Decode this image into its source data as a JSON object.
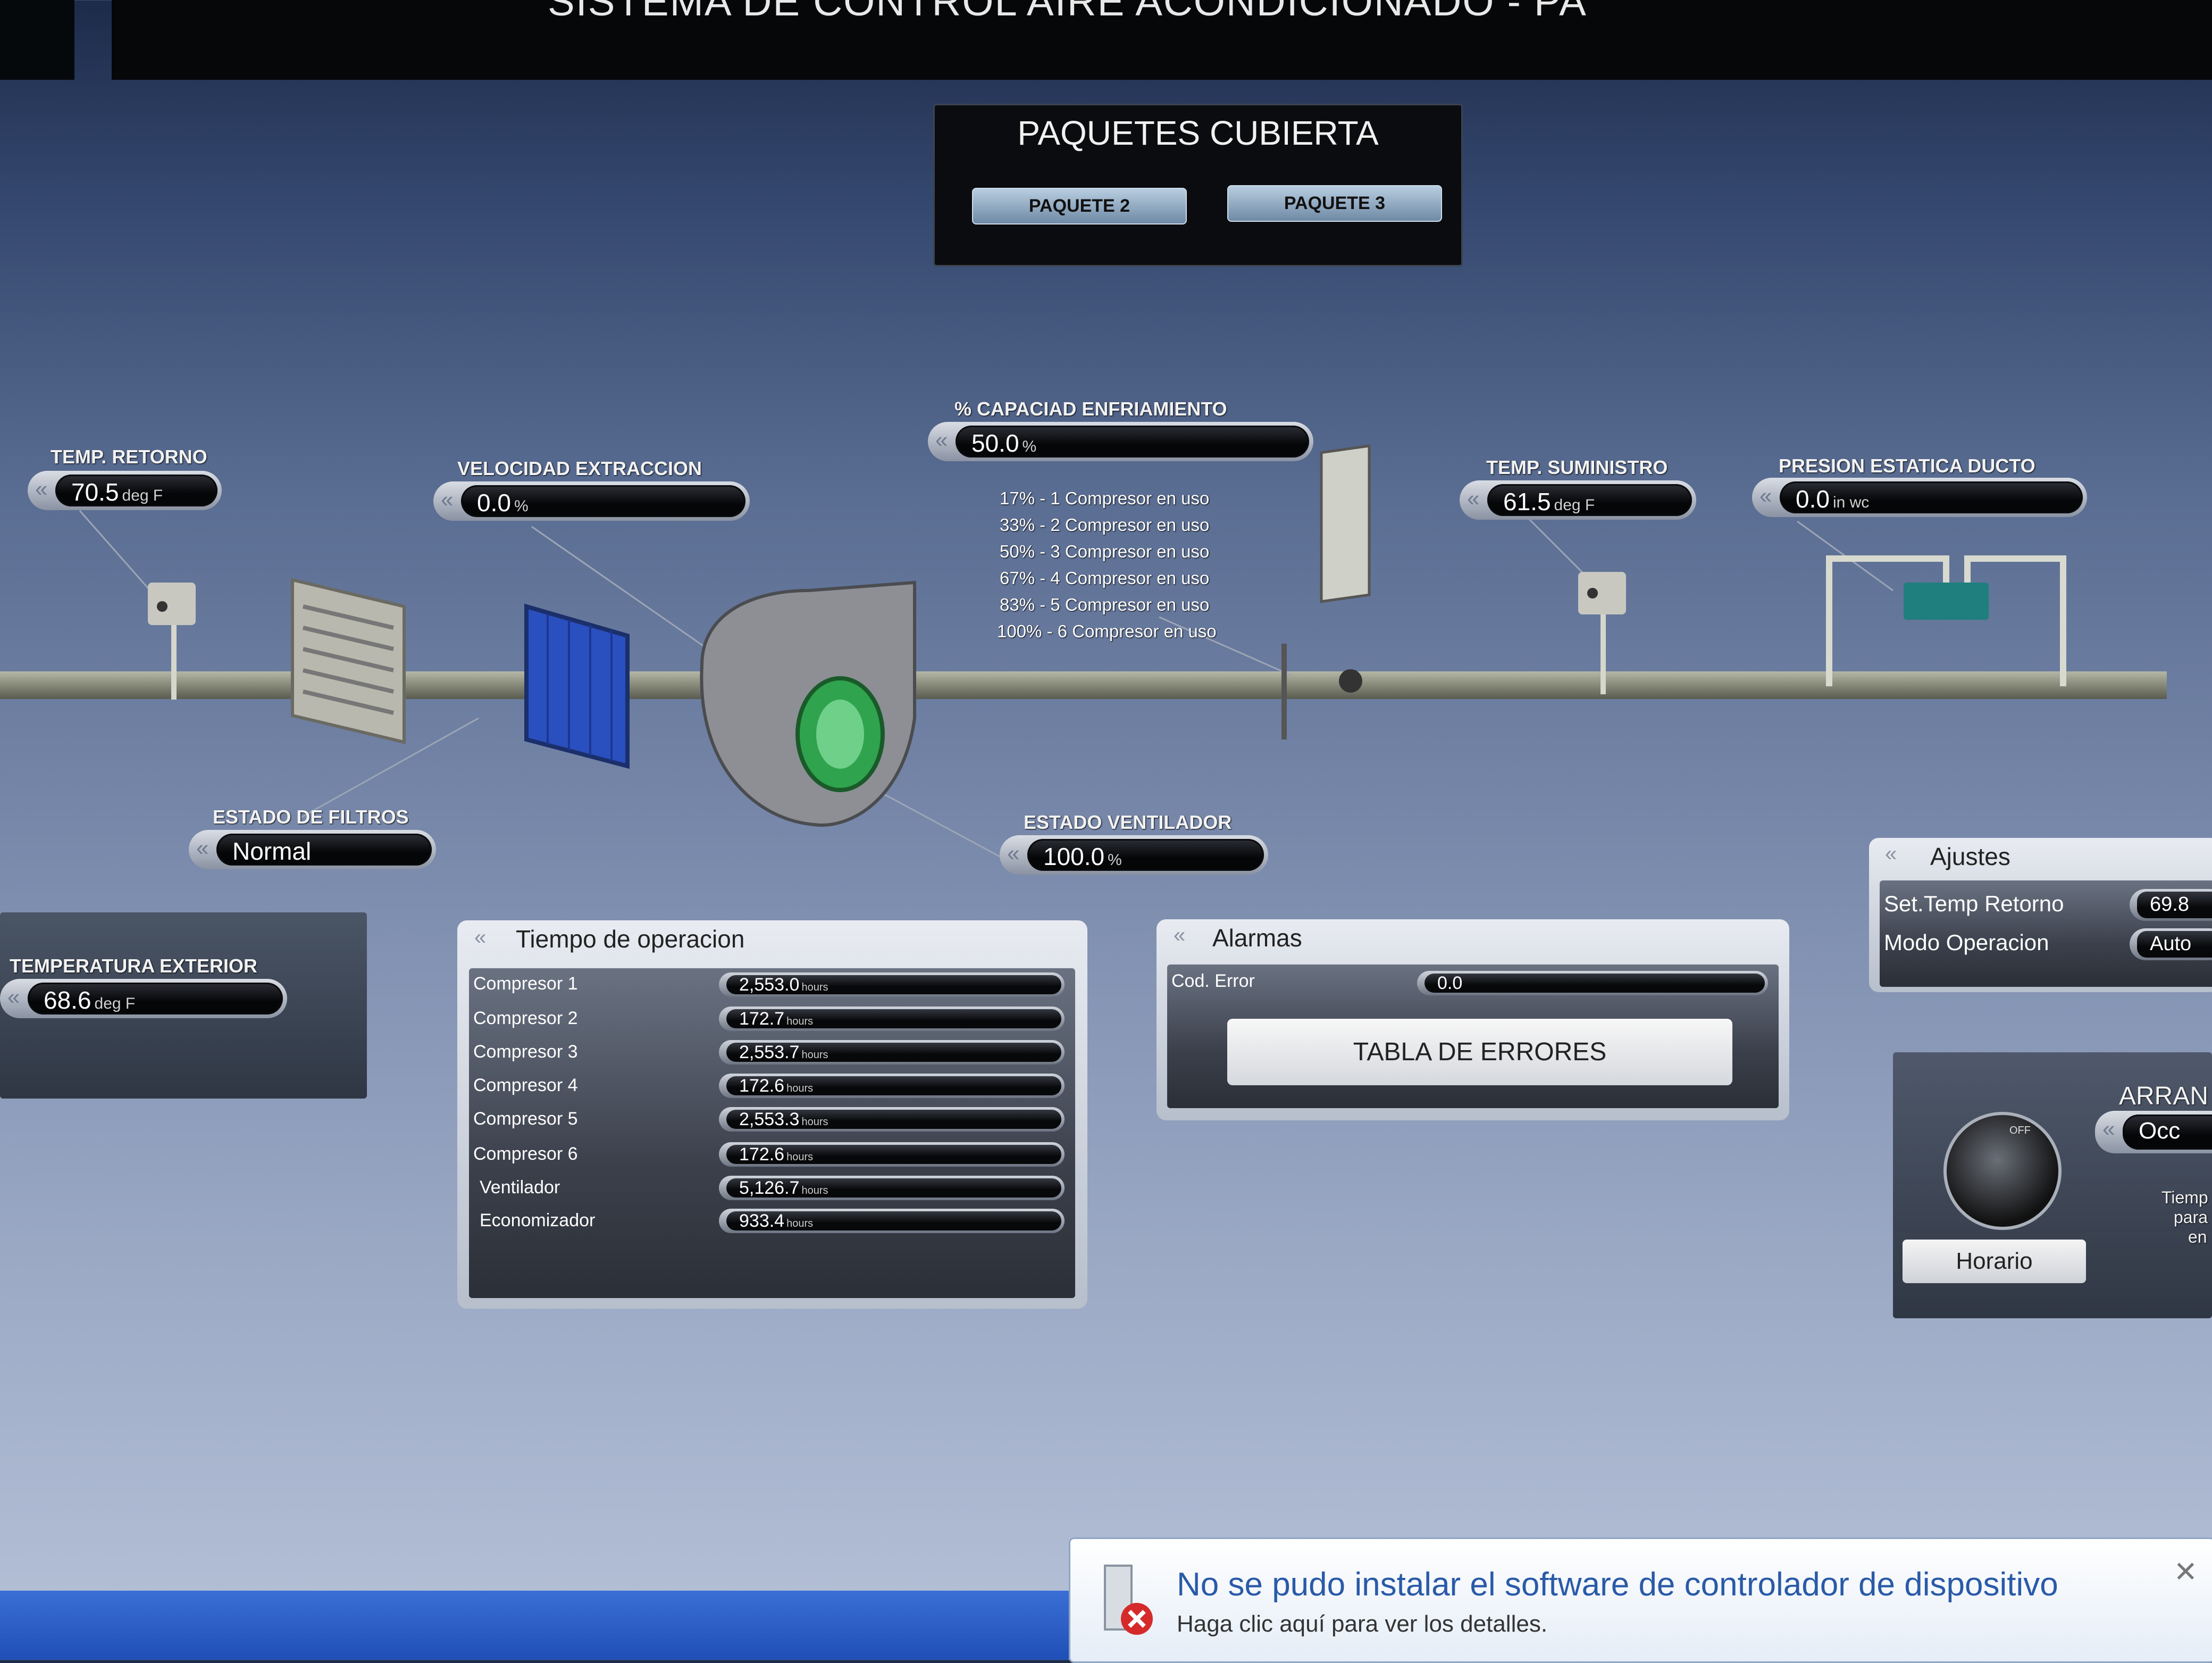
{
  "header": {
    "title": "SISTEMA DE CONTROL AIRE ACONDICIONADO - PA"
  },
  "paquetes": {
    "title": "PAQUETES CUBIERTA",
    "btn2": "PAQUETE 2",
    "btn3": "PAQUETE 3"
  },
  "sensors": {
    "temp_retorno": {
      "label": "TEMP. RETORNO",
      "value": "70.5",
      "unit": "deg F"
    },
    "vel_extraccion": {
      "label": "VELOCIDAD EXTRACCION",
      "value": "0.0",
      "unit": "%"
    },
    "capacidad": {
      "label": "% CAPACIAD ENFRIAMIENTO",
      "value": "50.0",
      "unit": "%"
    },
    "temp_suministro": {
      "label": "TEMP. SUMINISTRO",
      "value": "61.5",
      "unit": "deg F"
    },
    "presion": {
      "label": "PRESION ESTATICA  DUCTO",
      "value": "0.0",
      "unit": "in wc"
    },
    "estado_filtros": {
      "label": "ESTADO DE FILTROS",
      "value": "Normal"
    },
    "estado_ventilador": {
      "label": "ESTADO VENTILADOR",
      "value": "100.0",
      "unit": "%"
    },
    "temp_exterior": {
      "label": "TEMPERATURA EXTERIOR",
      "value": "68.6",
      "unit": "deg F"
    }
  },
  "compresores": [
    "17% - 1 Compresor en uso",
    "33% - 2 Compresor en uso",
    "50% - 3 Compresor en uso",
    "67% - 4 Compresor en uso",
    "83% - 5 Compresor en uso",
    "100% - 6 Compresor en uso"
  ],
  "tiempo": {
    "title": "Tiempo de operacion",
    "unit": "hours",
    "rows": [
      {
        "label": "Compresor 1",
        "value": "2,553.0"
      },
      {
        "label": "Compresor 2",
        "value": "172.7"
      },
      {
        "label": "Compresor 3",
        "value": "2,553.7"
      },
      {
        "label": "Compresor 4",
        "value": "172.6"
      },
      {
        "label": "Compresor 5",
        "value": "2,553.3"
      },
      {
        "label": "Compresor 6",
        "value": "172.6"
      },
      {
        "label": "Ventilador",
        "value": "5,126.7"
      },
      {
        "label": "Economizador",
        "value": "933.4"
      }
    ]
  },
  "alarmas": {
    "title": "Alarmas",
    "cod_label": "Cod. Error",
    "cod_value": "0.0",
    "button": "TABLA DE ERRORES"
  },
  "ajustes": {
    "title": "Ajustes",
    "rows": [
      {
        "label": "Set.Temp Retorno",
        "value": "69.8"
      },
      {
        "label": "Modo Operacion",
        "value": "Auto"
      }
    ]
  },
  "arranque": {
    "title": "ARRAN",
    "value": "Occ",
    "schedule": "Horario",
    "knob_off": "OFF",
    "side": [
      "Tiemp",
      "para",
      "en"
    ]
  },
  "chevron": "«",
  "notification": {
    "title": "No se pudo instalar el software de controlador de dispositivo",
    "detail": "Haga clic aquí para ver los detalles."
  },
  "colors": {
    "duct": "#8c8f7d",
    "fan_core": "#2fa34d",
    "filter": "#2a4fbf",
    "link": "#2a5aa8"
  }
}
